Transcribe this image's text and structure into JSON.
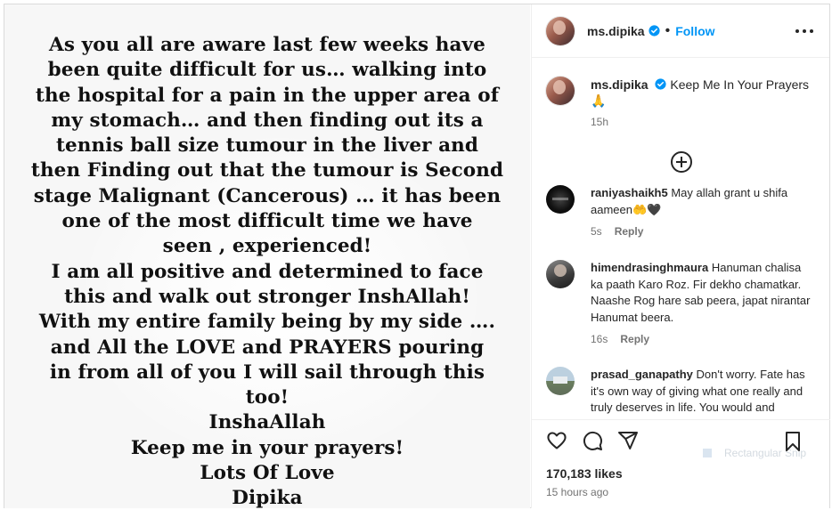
{
  "post": {
    "lines": [
      "As you all are aware last few weeks have",
      "been quite difficult for us… walking into",
      "the hospital for a pain in the upper area of",
      "my stomach… and then finding out its a",
      "tennis ball size tumour in the liver and",
      "then Finding out that the tumour is Second",
      "stage Malignant (Cancerous) … it has been",
      "one of the most difficult time we have",
      "seen , experienced!",
      "I am all positive and determined to face",
      "this and walk out stronger InshAllah!",
      "With my entire family being by my side ….",
      "and All the LOVE and PRAYERS pouring",
      "in from all of you I will sail through this",
      "too!",
      "InshaAllah",
      "Keep me in your prayers!",
      "Lots Of Love",
      "Dipika"
    ]
  },
  "header": {
    "username": "ms.dipika",
    "dot": "•",
    "follow_label": "Follow"
  },
  "caption": {
    "username": "ms.dipika",
    "text": "Keep Me In Your Prayers 🙏",
    "time": "15h"
  },
  "comments": [
    {
      "username": "raniyashaikh5",
      "text": "May allah grant u shifa aameen🤲🖤",
      "time": "5s",
      "reply": "Reply"
    },
    {
      "username": "himendrasinghmaura",
      "text": "Hanuman chalisa ka paath Karo Roz. Fir dekho chamatkar. Naashe Rog hare sab peera, japat nirantar Hanumat beera.",
      "time": "16s",
      "reply": "Reply"
    },
    {
      "username": "prasad_ganapathy",
      "text": "Don't worry. Fate has it's own way of giving what one really and truly deserves in life. You would and"
    }
  ],
  "overlay": {
    "watermark": "Rectangular Snip"
  },
  "stats": {
    "likes": "170,183 likes",
    "posted": "15 hours ago"
  },
  "colors": {
    "link": "#0095f6",
    "verified": "#0095f6",
    "muted": "#737373"
  },
  "icons": [
    "more-icon",
    "verified-badge-icon",
    "add-comment-icon",
    "heart-icon",
    "comment-icon",
    "share-icon",
    "bookmark-icon"
  ]
}
